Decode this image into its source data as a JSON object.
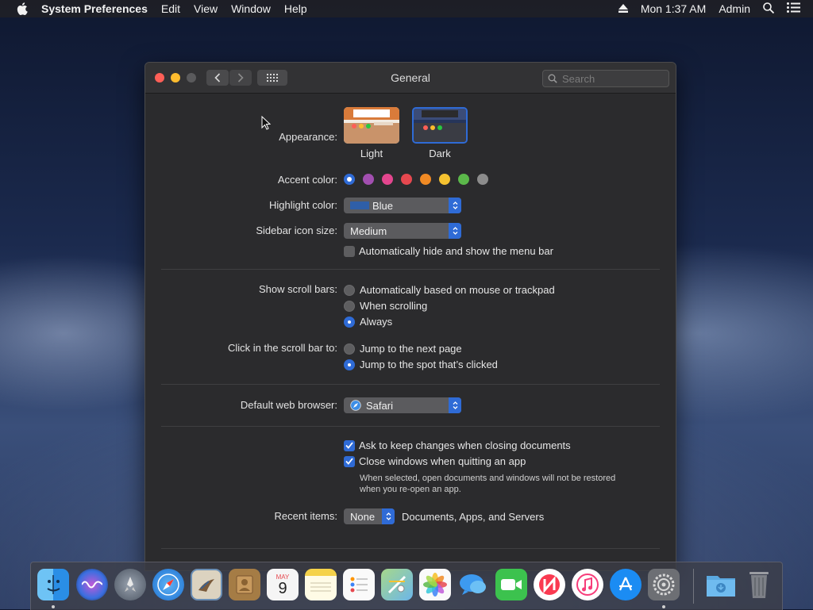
{
  "menubar": {
    "app_name": "System Preferences",
    "menus": [
      "Edit",
      "View",
      "Window",
      "Help"
    ],
    "clock": "Mon 1:37 AM",
    "user": "Admin"
  },
  "window": {
    "title": "General",
    "search_placeholder": "Search"
  },
  "appearance": {
    "label": "Appearance:",
    "options": [
      "Light",
      "Dark"
    ],
    "selected": "Dark"
  },
  "accent": {
    "label": "Accent color:",
    "colors": [
      "#2f6bd6",
      "#a24fb0",
      "#e3468e",
      "#e6484f",
      "#f08a24",
      "#f5c230",
      "#5bb84a",
      "#8c8c8c"
    ],
    "selected_index": 0
  },
  "highlight": {
    "label": "Highlight color:",
    "value": "Blue",
    "swatch_color": "#2f5fa8"
  },
  "sidebar_size": {
    "label": "Sidebar icon size:",
    "value": "Medium"
  },
  "menubar_autohide": {
    "label": "Automatically hide and show the menu bar",
    "checked": false
  },
  "scroll_bars": {
    "label": "Show scroll bars:",
    "options": [
      "Automatically based on mouse or trackpad",
      "When scrolling",
      "Always"
    ],
    "selected_index": 2
  },
  "scroll_click": {
    "label": "Click in the scroll bar to:",
    "options": [
      "Jump to the next page",
      "Jump to the spot that’s clicked"
    ],
    "selected_index": 1
  },
  "browser": {
    "label": "Default web browser:",
    "value": "Safari"
  },
  "documents": {
    "ask_keep_changes": "Ask to keep changes when closing documents",
    "close_windows": "Close windows when quitting an app",
    "note_line1": "When selected, open documents and windows will not be restored",
    "note_line2": "when you re-open an app."
  },
  "recent_items": {
    "label": "Recent items:",
    "value": "None",
    "suffix": "Documents, Apps, and Servers"
  },
  "dock": {
    "calendar_month": "MAY",
    "calendar_day": "9"
  }
}
